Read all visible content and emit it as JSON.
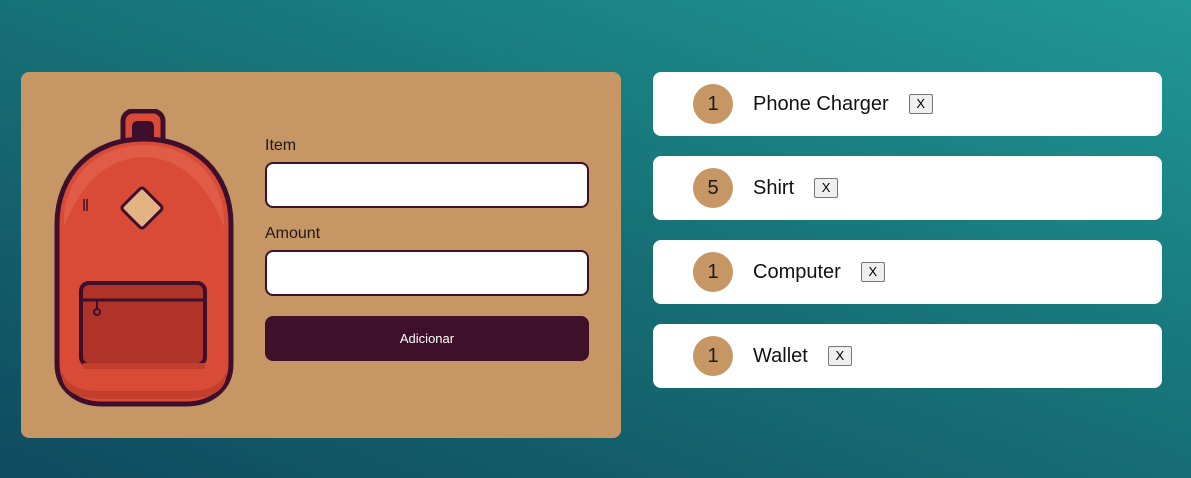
{
  "form": {
    "item_label": "Item",
    "item_value": "",
    "amount_label": "Amount",
    "amount_value": "",
    "submit_label": "Adicionar"
  },
  "items": [
    {
      "qty": "1",
      "name": "Phone Charger",
      "remove_label": "X"
    },
    {
      "qty": "5",
      "name": "Shirt",
      "remove_label": "X"
    },
    {
      "qty": "1",
      "name": "Computer",
      "remove_label": "X"
    },
    {
      "qty": "1",
      "name": "Wallet",
      "remove_label": "X"
    }
  ],
  "icons": {
    "illustration": "backpack-icon",
    "remove": "close-icon"
  },
  "colors": {
    "card_tan": "#c69764",
    "button_plum": "#3f102a",
    "backpack_red": "#d94b37",
    "background_teal": "#177377"
  }
}
